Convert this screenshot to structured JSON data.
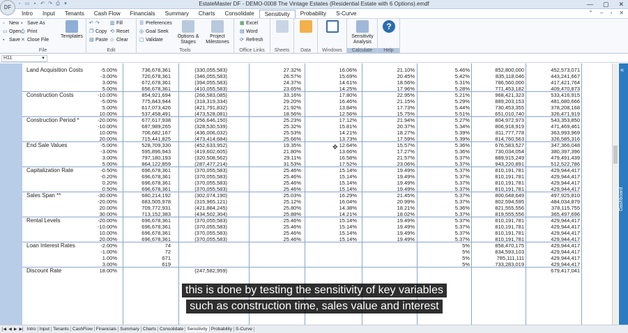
{
  "window": {
    "title": "EstateMaster DF - DEMO-0008 The Vintage Estates (Residential Estate with 6 Options).emdf",
    "logo": "DF"
  },
  "menu_tabs": [
    "Intro",
    "Input",
    "Tenants",
    "Cash Flow",
    "Financials",
    "Summary",
    "Charts",
    "Consolidate",
    "Sensitivity",
    "Probability",
    "S-Curve"
  ],
  "active_tab": "Sensitivity",
  "ribbon": {
    "file": {
      "label": "File",
      "new": "New",
      "save_as": "Save As",
      "open": "Open",
      "print": "Print",
      "save": "Save",
      "close_file": "Close File",
      "templates": "Templates"
    },
    "edit": {
      "label": "Edit",
      "fill": "Fill",
      "copy": "Copy",
      "reset": "Reset",
      "paste": "Paste",
      "clear": "Clear"
    },
    "tools": {
      "label": "Tools",
      "preferences": "Preferences",
      "goal_seek": "Goal Seek",
      "validate": "Validate",
      "options_stages": "Options & Stages",
      "project_milestones": "Project Milestones"
    },
    "office": {
      "label": "Office Links",
      "excel": "Excel",
      "word": "Word",
      "refresh": "Refresh"
    },
    "sheets": "Sheets",
    "data": "Data",
    "windows": "Windows",
    "calculate": {
      "label": "Calculate",
      "sensitivity": "Sensitivity Analysis"
    },
    "help": {
      "label": "Help"
    }
  },
  "name_box": "H11",
  "sheet_tabs": [
    "Intro",
    "Input",
    "Tenants",
    "CashFlow",
    "Financials",
    "Summary",
    "Charts",
    "Consolidate",
    "Sensitivity",
    "Probability",
    "S-Curve"
  ],
  "active_sheet": "Sensitivity",
  "dashboard_label": "Dashboard",
  "caption": [
    "this is done by testing the sensitivity of key variables",
    "such as construction time, sales value and interest"
  ],
  "rows": [
    {
      "label": "Land Acquisition Costs",
      "v": [
        "-5.00%",
        "736,678,361",
        "(330,055,583)",
        "27.32%",
        "16.06%",
        "21.10%",
        "5.46%",
        "852,800,000",
        "452,573,071"
      ]
    },
    {
      "label": "",
      "v": [
        "-3.00%",
        "720,678,361",
        "(346,055,583)",
        "26.57%",
        "15.69%",
        "20.45%",
        "5.42%",
        "835,118,046",
        "443,241,667"
      ]
    },
    {
      "label": "",
      "v": [
        "3.00%",
        "672,678,361",
        "(394,055,583)",
        "24.37%",
        "14.61%",
        "18.56%",
        "5.31%",
        "786,560,000",
        "417,421,764"
      ]
    },
    {
      "label": "",
      "v": [
        "5.00%",
        "656,678,361",
        "(410,055,583)",
        "23.65%",
        "14.25%",
        "17.96%",
        "5.28%",
        "771,453,182",
        "409,470,873"
      ]
    },
    {
      "label": "Construction Costs",
      "v": [
        "-10.00%",
        "854,921,694",
        "(266,583,085)",
        "33.16%",
        "17.80%",
        "22.95%",
        "5.21%",
        "968,421,323",
        "533,416,915"
      ]
    },
    {
      "label": "",
      "v": [
        "-5.00%",
        "775,843,944",
        "(318,319,334)",
        "29.20%",
        "16.46%",
        "21.15%",
        "5.29%",
        "889,203,153",
        "481,680,666"
      ]
    },
    {
      "label": "",
      "v": [
        "5.00%",
        "617,073,426",
        "(421,791,832)",
        "21.92%",
        "13.84%",
        "17.73%",
        "5.44%",
        "730,453,355",
        "378,208,168"
      ]
    },
    {
      "label": "",
      "v": [
        "10.00%",
        "537,458,491",
        "(473,528,081)",
        "18.56%",
        "12.56%",
        "15.75%",
        "5.51%",
        "651,010,740",
        "326,471,919"
      ]
    },
    {
      "label": "Construction Period *",
      "v": [
        "-20.00%",
        "677,617,938",
        "(256,646,150)",
        "25.23%",
        "17.12%",
        "21.94%",
        "5.27%",
        "804,972,973",
        "543,353,850"
      ]
    },
    {
      "label": "",
      "v": [
        "-10.00%",
        "687,989,265",
        "(328,530,539)",
        "25.32%",
        "15.81%",
        "20.37%",
        "5.34%",
        "806,918,919",
        "471,469,461"
      ]
    },
    {
      "label": "",
      "v": [
        "10.00%",
        "706,682,167",
        "(436,006,032)",
        "25.53%",
        "14.21%",
        "18.27%",
        "5.39%",
        "811,777,778",
        "363,993,969"
      ]
    },
    {
      "label": "",
      "v": [
        "20.00%",
        "715,441,825",
        "(473,414,684)",
        "25.66%",
        "13.73%",
        "17.59%",
        "5.39%",
        "814,760,563",
        "326,585,316"
      ]
    },
    {
      "label": "End Sale Values",
      "v": [
        "-5.00%",
        "528,709,330",
        "(452,633,952)",
        "19.35%",
        "12.64%",
        "15.57%",
        "5.36%",
        "676,583,527",
        "347,366,048"
      ]
    },
    {
      "label": "",
      "v": [
        "-3.00%",
        "595,896,943",
        "(419,602,605)",
        "21.80%",
        "13.66%",
        "17.27%",
        "5.36%",
        "730,034,054",
        "380,397,396"
      ]
    },
    {
      "label": "",
      "v": [
        "3.00%",
        "797,180,193",
        "(320,508,562)",
        "29.11%",
        "16.58%",
        "21.57%",
        "5.37%",
        "889,915,249",
        "479,491,439"
      ]
    },
    {
      "label": "",
      "v": [
        "5.00%",
        "864,122,859",
        "(287,477,214)",
        "31.53%",
        "17.52%",
        "23.06%",
        "5.37%",
        "943,220,891",
        "512,522,786"
      ]
    },
    {
      "label": "Capitalization Rate",
      "v": [
        "-0.50%",
        "696,678,361",
        "(370,055,583)",
        "25.46%",
        "15.14%",
        "19.49%",
        "5.37%",
        "810,191,781",
        "429,944,417"
      ]
    },
    {
      "label": "",
      "v": [
        "-0.20%",
        "696,678,361",
        "(370,055,583)",
        "25.46%",
        "15.14%",
        "19.49%",
        "5.37%",
        "810,191,781",
        "429,944,417"
      ]
    },
    {
      "label": "",
      "v": [
        "0.20%",
        "696,678,361",
        "(370,055,583)",
        "25.46%",
        "15.14%",
        "19.49%",
        "5.37%",
        "810,191,781",
        "429,944,417"
      ]
    },
    {
      "label": "",
      "v": [
        "0.50%",
        "696,678,361",
        "(370,055,583)",
        "25.46%",
        "15.14%",
        "19.49%",
        "5.37%",
        "810,191,781",
        "429,944,417"
      ]
    },
    {
      "label": "Sales Span **",
      "v": [
        "-30.00%",
        "680,214,192",
        "(302,074,190)",
        "25.03%",
        "16.29%",
        "21.45%",
        "5.37%",
        "800,648,649",
        "497,925,810"
      ]
    },
    {
      "label": "",
      "v": [
        "-20.00%",
        "683,505,978",
        "(315,965,121)",
        "25.12%",
        "16.04%",
        "20.99%",
        "5.37%",
        "802,594,595",
        "484,034,879"
      ]
    },
    {
      "label": "",
      "v": [
        "20.00%",
        "709,772,931",
        "(421,884,245)",
        "25.80%",
        "14.38%",
        "18.21%",
        "5.36%",
        "821,555,556",
        "378,115,755"
      ]
    },
    {
      "label": "",
      "v": [
        "30.00%",
        "713,152,383",
        "(434,502,304)",
        "25.88%",
        "14.21%",
        "18.02%",
        "5.37%",
        "819,555,556",
        "365,497,696"
      ]
    },
    {
      "label": "Rental Levels",
      "v": [
        "-20.00%",
        "696,678,361",
        "(370,055,583)",
        "25.46%",
        "15.14%",
        "19.49%",
        "5.37%",
        "810,191,781",
        "429,944,417"
      ]
    },
    {
      "label": "",
      "v": [
        "-10.00%",
        "696,678,361",
        "(370,055,583)",
        "25.46%",
        "15.14%",
        "19.49%",
        "5.37%",
        "810,191,781",
        "429,944,417"
      ]
    },
    {
      "label": "",
      "v": [
        "10.00%",
        "696,678,361",
        "(370,055,583)",
        "25.46%",
        "15.14%",
        "19.49%",
        "5.37%",
        "810,191,781",
        "429,944,417"
      ]
    },
    {
      "label": "",
      "v": [
        "20.00%",
        "696,678,361",
        "(370,055,583)",
        "25.46%",
        "15.14%",
        "19.49%",
        "5.37%",
        "810,191,781",
        "429,944,417"
      ]
    },
    {
      "label": "Loan Interest Rates",
      "v": [
        "-2.00%",
        "74",
        "",
        "",
        "",
        "",
        "5%",
        "858,470,175",
        "429,944,417"
      ]
    },
    {
      "label": "",
      "v": [
        "-1.00%",
        "72",
        "",
        "",
        "",
        "",
        "5%",
        "834,593,103",
        "429,944,417"
      ]
    },
    {
      "label": "",
      "v": [
        "1.00%",
        "671",
        "",
        "",
        "",
        "",
        "5%",
        "785,111,111",
        "429,944,417"
      ]
    },
    {
      "label": "",
      "v": [
        "3.00%",
        "619",
        "",
        "",
        "",
        "",
        "5%",
        "733,283,019",
        "429,944,417"
      ]
    },
    {
      "label": "Discount Rate",
      "v": [
        "18.00%",
        "",
        "(247,582,959)",
        "",
        "",
        "",
        "",
        "",
        "679,417,041"
      ]
    }
  ]
}
